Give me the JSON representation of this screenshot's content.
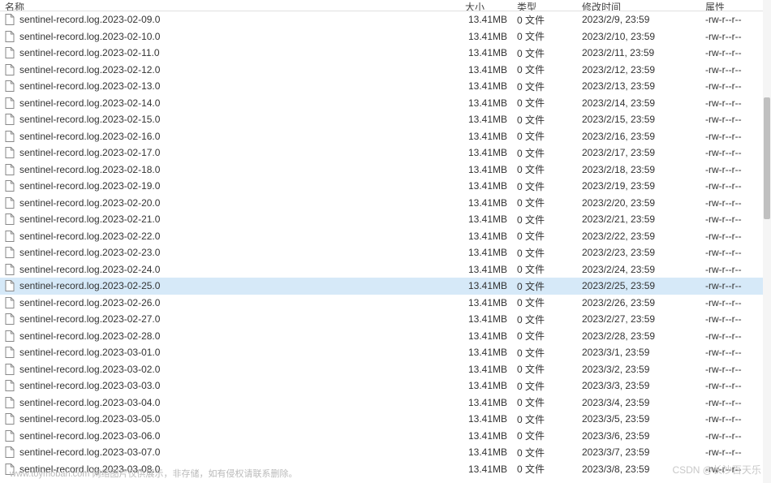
{
  "columns": {
    "name": "名称",
    "size": "大小",
    "type": "类型",
    "mtime": "修改时间",
    "attr": "属性"
  },
  "files": [
    {
      "name": "sentinel-record.log.2023-02-09.0",
      "size": "13.41MB",
      "type": "0 文件",
      "mtime": "2023/2/9, 23:59",
      "attr": "-rw-r--r--"
    },
    {
      "name": "sentinel-record.log.2023-02-10.0",
      "size": "13.41MB",
      "type": "0 文件",
      "mtime": "2023/2/10, 23:59",
      "attr": "-rw-r--r--"
    },
    {
      "name": "sentinel-record.log.2023-02-11.0",
      "size": "13.41MB",
      "type": "0 文件",
      "mtime": "2023/2/11, 23:59",
      "attr": "-rw-r--r--"
    },
    {
      "name": "sentinel-record.log.2023-02-12.0",
      "size": "13.41MB",
      "type": "0 文件",
      "mtime": "2023/2/12, 23:59",
      "attr": "-rw-r--r--"
    },
    {
      "name": "sentinel-record.log.2023-02-13.0",
      "size": "13.41MB",
      "type": "0 文件",
      "mtime": "2023/2/13, 23:59",
      "attr": "-rw-r--r--"
    },
    {
      "name": "sentinel-record.log.2023-02-14.0",
      "size": "13.41MB",
      "type": "0 文件",
      "mtime": "2023/2/14, 23:59",
      "attr": "-rw-r--r--"
    },
    {
      "name": "sentinel-record.log.2023-02-15.0",
      "size": "13.41MB",
      "type": "0 文件",
      "mtime": "2023/2/15, 23:59",
      "attr": "-rw-r--r--"
    },
    {
      "name": "sentinel-record.log.2023-02-16.0",
      "size": "13.41MB",
      "type": "0 文件",
      "mtime": "2023/2/16, 23:59",
      "attr": "-rw-r--r--"
    },
    {
      "name": "sentinel-record.log.2023-02-17.0",
      "size": "13.41MB",
      "type": "0 文件",
      "mtime": "2023/2/17, 23:59",
      "attr": "-rw-r--r--"
    },
    {
      "name": "sentinel-record.log.2023-02-18.0",
      "size": "13.41MB",
      "type": "0 文件",
      "mtime": "2023/2/18, 23:59",
      "attr": "-rw-r--r--"
    },
    {
      "name": "sentinel-record.log.2023-02-19.0",
      "size": "13.41MB",
      "type": "0 文件",
      "mtime": "2023/2/19, 23:59",
      "attr": "-rw-r--r--"
    },
    {
      "name": "sentinel-record.log.2023-02-20.0",
      "size": "13.41MB",
      "type": "0 文件",
      "mtime": "2023/2/20, 23:59",
      "attr": "-rw-r--r--"
    },
    {
      "name": "sentinel-record.log.2023-02-21.0",
      "size": "13.41MB",
      "type": "0 文件",
      "mtime": "2023/2/21, 23:59",
      "attr": "-rw-r--r--"
    },
    {
      "name": "sentinel-record.log.2023-02-22.0",
      "size": "13.41MB",
      "type": "0 文件",
      "mtime": "2023/2/22, 23:59",
      "attr": "-rw-r--r--"
    },
    {
      "name": "sentinel-record.log.2023-02-23.0",
      "size": "13.41MB",
      "type": "0 文件",
      "mtime": "2023/2/23, 23:59",
      "attr": "-rw-r--r--"
    },
    {
      "name": "sentinel-record.log.2023-02-24.0",
      "size": "13.41MB",
      "type": "0 文件",
      "mtime": "2023/2/24, 23:59",
      "attr": "-rw-r--r--"
    },
    {
      "name": "sentinel-record.log.2023-02-25.0",
      "size": "13.41MB",
      "type": "0 文件",
      "mtime": "2023/2/25, 23:59",
      "attr": "-rw-r--r--",
      "selected": true
    },
    {
      "name": "sentinel-record.log.2023-02-26.0",
      "size": "13.41MB",
      "type": "0 文件",
      "mtime": "2023/2/26, 23:59",
      "attr": "-rw-r--r--"
    },
    {
      "name": "sentinel-record.log.2023-02-27.0",
      "size": "13.41MB",
      "type": "0 文件",
      "mtime": "2023/2/27, 23:59",
      "attr": "-rw-r--r--"
    },
    {
      "name": "sentinel-record.log.2023-02-28.0",
      "size": "13.41MB",
      "type": "0 文件",
      "mtime": "2023/2/28, 23:59",
      "attr": "-rw-r--r--"
    },
    {
      "name": "sentinel-record.log.2023-03-01.0",
      "size": "13.41MB",
      "type": "0 文件",
      "mtime": "2023/3/1, 23:59",
      "attr": "-rw-r--r--"
    },
    {
      "name": "sentinel-record.log.2023-03-02.0",
      "size": "13.41MB",
      "type": "0 文件",
      "mtime": "2023/3/2, 23:59",
      "attr": "-rw-r--r--"
    },
    {
      "name": "sentinel-record.log.2023-03-03.0",
      "size": "13.41MB",
      "type": "0 文件",
      "mtime": "2023/3/3, 23:59",
      "attr": "-rw-r--r--"
    },
    {
      "name": "sentinel-record.log.2023-03-04.0",
      "size": "13.41MB",
      "type": "0 文件",
      "mtime": "2023/3/4, 23:59",
      "attr": "-rw-r--r--"
    },
    {
      "name": "sentinel-record.log.2023-03-05.0",
      "size": "13.41MB",
      "type": "0 文件",
      "mtime": "2023/3/5, 23:59",
      "attr": "-rw-r--r--"
    },
    {
      "name": "sentinel-record.log.2023-03-06.0",
      "size": "13.41MB",
      "type": "0 文件",
      "mtime": "2023/3/6, 23:59",
      "attr": "-rw-r--r--"
    },
    {
      "name": "sentinel-record.log.2023-03-07.0",
      "size": "13.41MB",
      "type": "0 文件",
      "mtime": "2023/3/7, 23:59",
      "attr": "-rw-r--r--"
    },
    {
      "name": "sentinel-record.log.2023-03-08.0",
      "size": "13.41MB",
      "type": "0 文件",
      "mtime": "2023/3/8, 23:59",
      "attr": "-rw-r--r--"
    }
  ],
  "watermarks": {
    "bottom": "www.toymoban.com 网络图片仅供展示，非存储，如有侵权请联系删除。",
    "right": "CSDN @长沙百天乐"
  }
}
